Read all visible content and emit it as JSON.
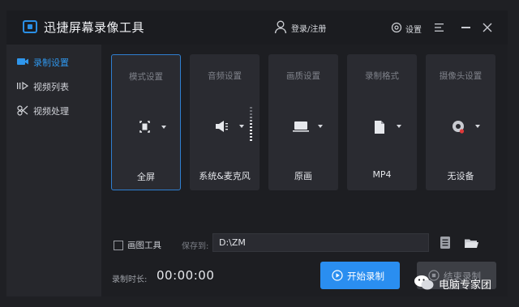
{
  "app": {
    "title": "迅捷屏幕录像工具",
    "accent": "#2a8ef0"
  },
  "header": {
    "login": "登录/注册",
    "settings": "设置"
  },
  "sidebar": {
    "items": [
      {
        "label": "录制设置",
        "icon": "record-camera-icon",
        "active": true
      },
      {
        "label": "视频列表",
        "icon": "video-list-icon",
        "active": false
      },
      {
        "label": "视频处理",
        "icon": "video-process-icon",
        "active": false
      }
    ]
  },
  "cards": [
    {
      "title": "模式设置",
      "value": "全屏",
      "icon": "fullscreen-icon",
      "selected": true
    },
    {
      "title": "音频设置",
      "value": "系统&麦克风",
      "icon": "speaker-icon"
    },
    {
      "title": "画质设置",
      "value": "原画",
      "icon": "monitor-icon"
    },
    {
      "title": "录制格式",
      "value": "MP4",
      "icon": "file-icon"
    },
    {
      "title": "摄像头设置",
      "value": "无设备",
      "icon": "webcam-icon"
    }
  ],
  "controls": {
    "draw_tool": "画图工具",
    "draw_tool_checked": false,
    "save_label": "保存到:",
    "save_path": "D:\\ZM",
    "duration_label": "录制时长:",
    "duration_value": "00:00:00",
    "start_button": "开始录制",
    "stop_button": "结束录制"
  },
  "watermark": {
    "text": "电脑专家团"
  }
}
